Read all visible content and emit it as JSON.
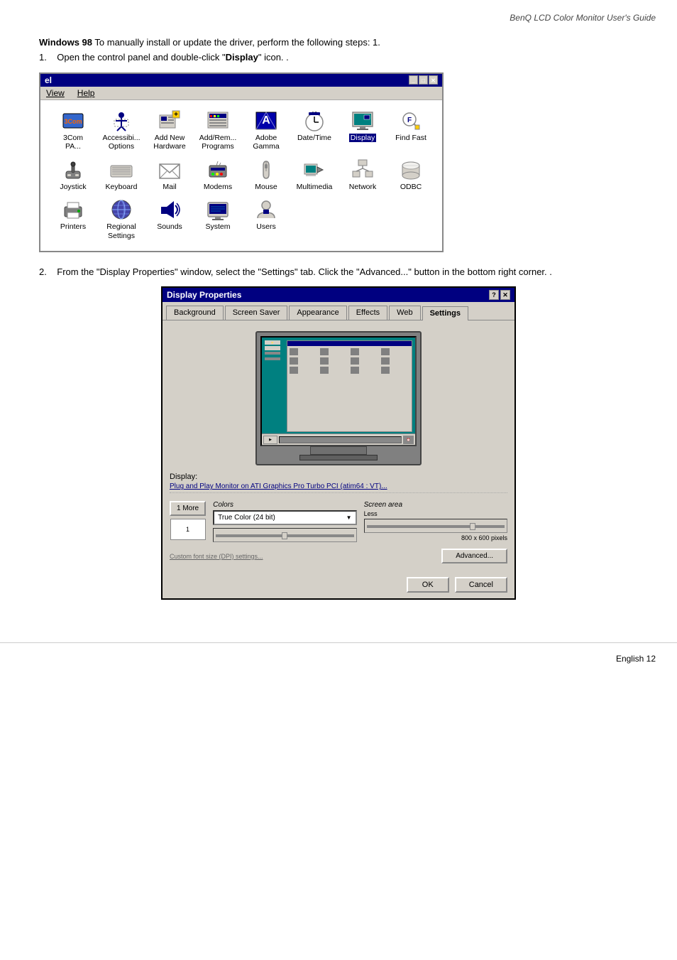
{
  "header": {
    "title": "BenQ LCD Color Monitor User's Guide"
  },
  "step1": {
    "intro_bold": "Windows 98",
    "intro_text": " To manually install or update the driver, perform the following steps: 1.",
    "step1_text": "1.    Open the control panel and double-click \"",
    "step1_bold": "Display",
    "step1_text2": "\" icon.  ."
  },
  "controlPanel": {
    "title": "el",
    "menu": [
      "View",
      "Help"
    ],
    "icons": [
      {
        "id": "3com",
        "label": "3Com\nPA...",
        "highlighted": false
      },
      {
        "id": "accessibility",
        "label": "Accessibi...\nOptions",
        "highlighted": false
      },
      {
        "id": "addnew",
        "label": "Add New\nHardware",
        "highlighted": false
      },
      {
        "id": "addremove",
        "label": "Add/Rem...\nPrograms",
        "highlighted": false
      },
      {
        "id": "adobe",
        "label": "Adobe\nGamma",
        "highlighted": false
      },
      {
        "id": "datetime",
        "label": "Date/Time",
        "highlighted": false
      },
      {
        "id": "display",
        "label": "Display",
        "highlighted": true
      },
      {
        "id": "findfast",
        "label": "Find Fast",
        "highlighted": false
      },
      {
        "id": "joystick",
        "label": "Joystick",
        "highlighted": false
      },
      {
        "id": "keyboard",
        "label": "Keyboard",
        "highlighted": false
      },
      {
        "id": "mail",
        "label": "Mail",
        "highlighted": false
      },
      {
        "id": "modems",
        "label": "Modems",
        "highlighted": false
      },
      {
        "id": "mouse",
        "label": "Mouse",
        "highlighted": false
      },
      {
        "id": "multimedia",
        "label": "Multimedia",
        "highlighted": false
      },
      {
        "id": "network",
        "label": "Network",
        "highlighted": false
      },
      {
        "id": "odbc",
        "label": "ODBC",
        "highlighted": false
      },
      {
        "id": "printers",
        "label": "Printers",
        "highlighted": false
      },
      {
        "id": "regional",
        "label": "Regional\nSettings",
        "highlighted": false
      },
      {
        "id": "sounds",
        "label": "Sounds",
        "highlighted": false
      },
      {
        "id": "system",
        "label": "System",
        "highlighted": false
      },
      {
        "id": "users",
        "label": "Users",
        "highlighted": false
      }
    ]
  },
  "step2": {
    "text_pre": "2.    From the \"",
    "bold1": "Display Properties",
    "text2": "\" window, select the \"",
    "bold2": "Settings",
    "text3": "\" tab. Click the \"",
    "bold3": "Advanced...",
    "text4": "\" button in the bottom right corner.  ."
  },
  "displayProperties": {
    "title": "Display Properties",
    "tabs": [
      "Background",
      "Screen Saver",
      "Appearance",
      "Effects",
      "Web",
      "Settings"
    ],
    "active_tab": "Settings",
    "display_label": "Display:",
    "display_driver": "Plug and Play Monitor on ATI Graphics Pro Turbo PCI (atim64 : VT)...",
    "colors_label": "Colors",
    "colors_value": "True Color (24 bit)",
    "screen_area_label": "Screen area",
    "screen_area_less": "Less",
    "screen_area_value": "800 x 600 pixels",
    "buttons": {
      "more": "1 More",
      "ok": "OK",
      "cancel": "Cancel",
      "advanced": "Advanced..."
    }
  },
  "footer": {
    "text": "English  12"
  }
}
